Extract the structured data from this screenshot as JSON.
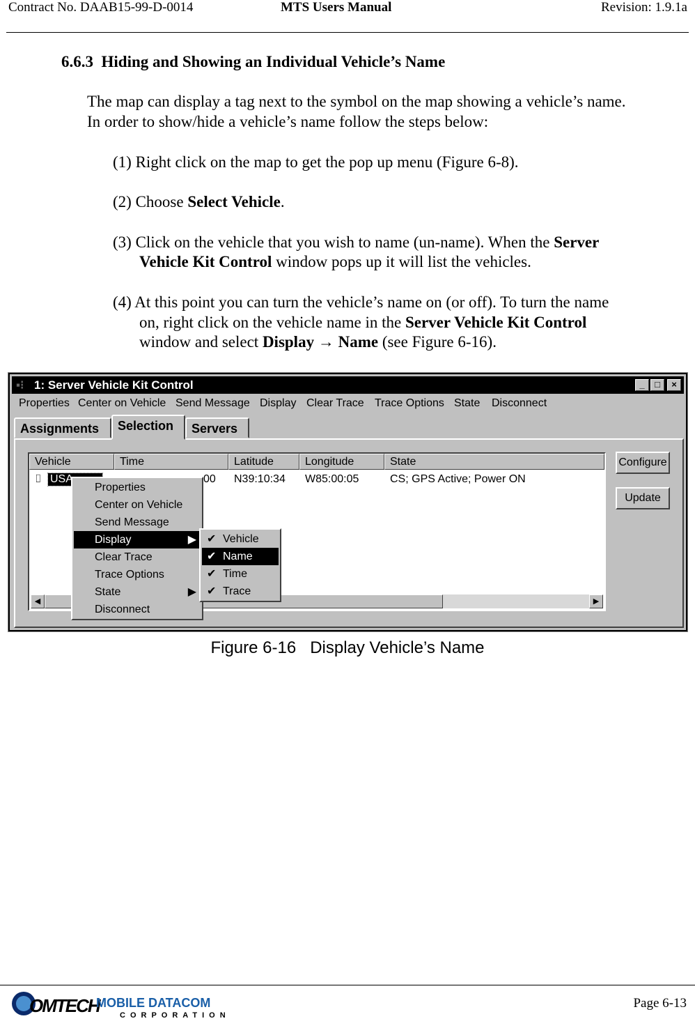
{
  "header": {
    "left": "Contract No. DAAB15-99-D-0014",
    "center": "MTS Users Manual",
    "right": "Revision:  1.9.1a"
  },
  "section": {
    "number": "6.6.3",
    "title": "Hiding and Showing an Individual Vehicle’s Name"
  },
  "intro": [
    "The map can display a tag next to the symbol on the map showing a vehicle’s name.",
    "In order to show/hide a vehicle’s name follow the steps below:"
  ],
  "steps": {
    "s1": "(1) Right click on the map to get the pop up menu (Figure 6-8).",
    "s2a": "(2) Choose ",
    "s2b": "Select Vehicle",
    "s2c": ".",
    "s3a": "(3) Click on the vehicle that you wish to name (un-name).  When the ",
    "s3b": "Server",
    "s3c": "Vehicle Kit Control",
    "s3d": " window pops up it will list the vehicles.",
    "s4a": "(4) At this point you can turn the vehicle’s name on (or off).  To turn the name",
    "s4b": "on, right click on the vehicle name in the ",
    "s4c": "Server Vehicle Kit Control",
    "s4d": "window and select ",
    "s4e": "Display",
    "s4f": " → ",
    "s4g": "Name",
    "s4h": " (see Figure 6-16)."
  },
  "window": {
    "title": "1: Server Vehicle Kit Control",
    "menu": [
      "Properties",
      "Center on Vehicle",
      "Send Message",
      "Display",
      "Clear Trace",
      "Trace Options",
      "State",
      "Disconnect"
    ],
    "tabs": [
      "Assignments",
      "Selection",
      "Servers"
    ],
    "columns": [
      "Vehicle",
      "Time",
      "Latitude",
      "Longitude",
      "State"
    ],
    "row": {
      "vehicle": "USA",
      "time": "00",
      "latitude": "N39:10:34",
      "longitude": "W85:00:05",
      "state": "CS; GPS Active; Power ON"
    },
    "buttons": {
      "configure": "Configure",
      "update": "Update"
    },
    "context_menu": [
      "Properties",
      "Center on Vehicle",
      "Send Message",
      "Display",
      "Clear Trace",
      "Trace Options",
      "State",
      "Disconnect"
    ],
    "submenu": [
      "Vehicle",
      "Name",
      "Time",
      "Trace"
    ]
  },
  "caption": "Figure 6-16   Display Vehicle’s Name",
  "footer": {
    "logo": "COMTECH MOBILE DATACOM CORPORATION",
    "page": "Page 6-13"
  },
  "colors": {
    "logo_blue": "#1a5fa8",
    "logo_navy": "#0a2a6a"
  }
}
